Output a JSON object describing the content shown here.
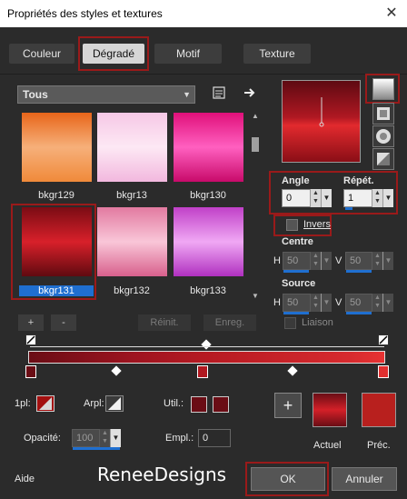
{
  "window": {
    "title": "Propriétés des styles et textures",
    "close_glyph": "✕"
  },
  "tabs": [
    {
      "label": "Couleur"
    },
    {
      "label": "Dégradé"
    },
    {
      "label": "Motif"
    },
    {
      "label": "Texture"
    }
  ],
  "category_dropdown": {
    "value": "Tous"
  },
  "swatches": [
    {
      "label": "bkgr129",
      "colors": [
        "#e8651a",
        "#f6b07a",
        "#f08a3a"
      ]
    },
    {
      "label": "bkgr13",
      "colors": [
        "#f6c8e6",
        "#fde8f4",
        "#f2b8de"
      ]
    },
    {
      "label": "bkgr130",
      "colors": [
        "#e0107a",
        "#ff60c0",
        "#c80a6a"
      ]
    },
    {
      "label": "bkgr131",
      "colors": [
        "#7a0c14",
        "#d8202a",
        "#600a10"
      ]
    },
    {
      "label": "bkgr132",
      "colors": [
        "#e27aa0",
        "#f9c6d8",
        "#d8608c"
      ]
    },
    {
      "label": "bkgr133",
      "colors": [
        "#c040c8",
        "#f0a8f4",
        "#b030c0"
      ]
    }
  ],
  "selected_swatch": "bkgr131",
  "buttons": {
    "add": "+",
    "remove": "-",
    "reset": "Réinit.",
    "save": "Enreg."
  },
  "angle": {
    "label": "Angle",
    "value": "0"
  },
  "repeat": {
    "label": "Répét.",
    "value": "1"
  },
  "invert": {
    "label": "Invers",
    "checked": false
  },
  "center": {
    "label": "Centre",
    "h_label": "H",
    "h_value": "50",
    "v_label": "V",
    "v_value": "50"
  },
  "source": {
    "label": "Source",
    "h_label": "H",
    "h_value": "50",
    "v_label": "V",
    "v_value": "50"
  },
  "link": {
    "label": "Liaison",
    "checked": false
  },
  "gradient_editor": {
    "style_label": "1pl:",
    "arpl_label": "Arpl:",
    "util_label": "Util.:",
    "opacity_label": "Opacité:",
    "opacity_value": "100",
    "empl_label": "Empl.:",
    "empl_value": "0"
  },
  "current_colors": {
    "actual_label": "Actuel",
    "previous_label": "Préc.",
    "actual_color": "#a0101a",
    "previous_color": "#b8201e"
  },
  "footer": {
    "help_label": "Aide",
    "ok_label": "OK",
    "cancel_label": "Annuler",
    "watermark": "ReneeDesigns"
  },
  "colors": {
    "accent": "#1f6fd0",
    "highlight_box": "#9a1a1a"
  }
}
